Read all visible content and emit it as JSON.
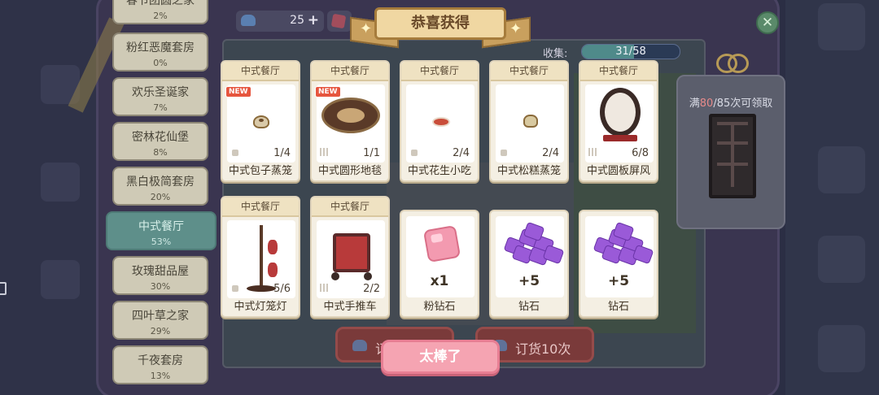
{
  "categories": [
    {
      "name": "春节团圆之家",
      "percent": "2%"
    },
    {
      "name": "粉红恶魔套房",
      "percent": "0%"
    },
    {
      "name": "欢乐圣诞家",
      "percent": "7%"
    },
    {
      "name": "密林花仙堡",
      "percent": "8%"
    },
    {
      "name": "黑白极简套房",
      "percent": "20%"
    },
    {
      "name": "中式餐厅",
      "percent": "53%"
    },
    {
      "name": "玫瑰甜品屋",
      "percent": "30%"
    },
    {
      "name": "四叶草之家",
      "percent": "29%"
    },
    {
      "name": "千夜套房",
      "percent": "13%"
    }
  ],
  "topbar": {
    "coins": "25",
    "plus": "+"
  },
  "collect": {
    "label": "收集:",
    "text": "31/58",
    "fraction": 0.534
  },
  "side_reward": {
    "prefix": "满",
    "highlight": "80",
    "suffix": "/85次可领取"
  },
  "close_glyph": "✕",
  "banner": {
    "title": "恭喜获得"
  },
  "items": [
    {
      "category": "中式餐厅",
      "name": "中式包子蒸笼",
      "count": "1/4",
      "new": true,
      "icon": "steamed-bun-icon"
    },
    {
      "category": "中式餐厅",
      "name": "中式圆形地毯",
      "count": "1/1",
      "new": true,
      "icon": "round-rug-icon"
    },
    {
      "category": "中式餐厅",
      "name": "中式花生小吃",
      "count": "2/4",
      "new": false,
      "icon": "peanut-snack-icon"
    },
    {
      "category": "中式餐厅",
      "name": "中式松糕蒸笼",
      "count": "2/4",
      "new": false,
      "icon": "sponge-cake-icon"
    },
    {
      "category": "中式餐厅",
      "name": "中式圆板屏风",
      "count": "6/8",
      "new": false,
      "icon": "round-screen-icon"
    },
    {
      "category": "中式餐厅",
      "name": "中式灯笼灯",
      "count": "5/6",
      "new": false,
      "icon": "lantern-lamp-icon"
    },
    {
      "category": "中式餐厅",
      "name": "中式手推车",
      "count": "2/2",
      "new": false,
      "icon": "hand-cart-icon"
    }
  ],
  "new_badge": "NEW",
  "rewards": [
    {
      "amount": "x1",
      "name": "粉钻石",
      "icon": "pink-diamond-icon"
    },
    {
      "amount": "+5",
      "name": "钻石",
      "icon": "diamond-pile-icon"
    },
    {
      "amount": "+5",
      "name": "钻石",
      "icon": "diamond-pile-icon"
    }
  ],
  "buttons": {
    "ok": "太棒了",
    "order_once": "订货1次",
    "order_ten": "订货10次"
  },
  "colors": {
    "ok_button": "#f5a4b2",
    "active_category": "#5e8f8a",
    "banner": "#f0d7a2"
  }
}
